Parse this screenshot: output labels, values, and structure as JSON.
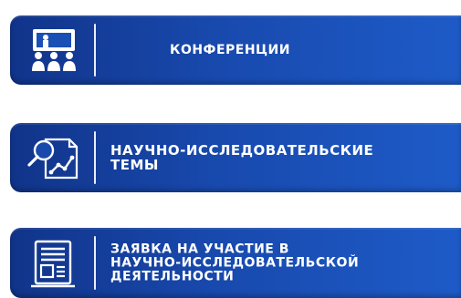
{
  "menu": {
    "items": [
      {
        "label": "КОНФЕРЕНЦИИ",
        "icon": "conference-audience-icon"
      },
      {
        "label": "НАУЧНО-ИССЛЕДОВАТЕЛЬСКИЕ\nТЕМЫ",
        "icon": "research-chart-icon"
      },
      {
        "label": "ЗАЯВКА НА УЧАСТИЕ В\nНАУЧНО-ИССЛЕДОВАТЕЛЬСКОЙ\nДЕЯТЕЛЬНОСТИ",
        "icon": "application-form-icon"
      }
    ]
  },
  "colors": {
    "button_dark": "#11348a",
    "button_light": "#1e5bc8",
    "text": "#ffffff"
  }
}
